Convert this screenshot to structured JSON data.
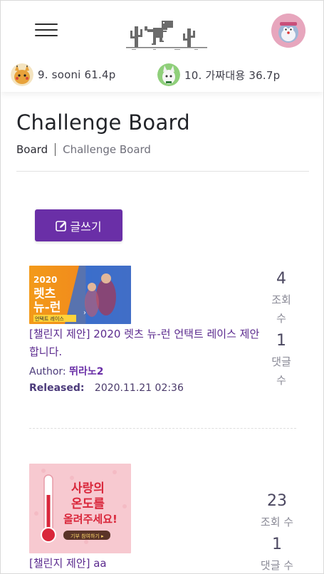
{
  "header": {
    "menu_icon": "hamburger-menu-icon",
    "logo_icon": "dinosaur-cactus-logo",
    "profile_icon": "user-avatar",
    "ranking": [
      {
        "rank_text": "9. sooni 61.4p",
        "avatar_icon": "pikachu-avatar"
      },
      {
        "rank_text": "10. 가짜대용 36.7p",
        "avatar_icon": "character-avatar"
      }
    ]
  },
  "page": {
    "title": "Challenge Board",
    "breadcrumb": {
      "root": "Board",
      "current": "Challenge Board"
    }
  },
  "write_button": {
    "label": "글쓰기",
    "icon": "edit-icon"
  },
  "posts": [
    {
      "thumbnail": {
        "year": "2020",
        "line1": "렛츠",
        "line2": "뉴-런",
        "tag": "언택트 레이스"
      },
      "title": "[챌린지 제안] 2020 렛츠 뉴-런 언택트 레이스 제안합니다.",
      "author_label": "Author:",
      "author": "뛰라노2",
      "released_label": "Released:",
      "released": "2020.11.21 02:36",
      "views": "4",
      "views_label": "조회 수",
      "comments": "1",
      "comments_label": "댓글 수"
    },
    {
      "thumbnail": {
        "line1": "사랑의",
        "line2": "온도를",
        "line3": "올려주세요!",
        "button": "기부 참여하기 ▸"
      },
      "title": "[챌린지 제안] aa",
      "views": "23",
      "views_label": "조회 수",
      "comments": "1",
      "comments_label": "댓글 수"
    }
  ],
  "colors": {
    "accent": "#6a2fa7",
    "link": "#5b2a8e",
    "thumb1_orange": "#f39a1a",
    "thumb1_blue": "#2f6fd6",
    "thumb2_pink": "#f7c9d0",
    "thumb2_red": "#d9263a"
  }
}
